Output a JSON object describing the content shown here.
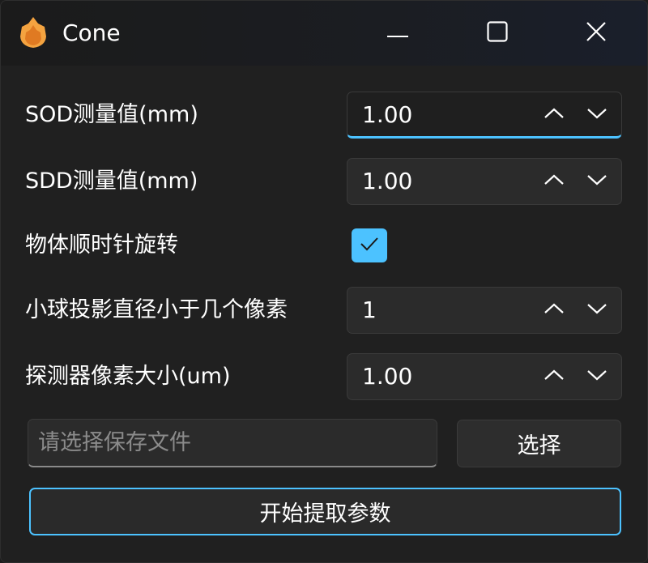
{
  "window": {
    "title": "Cone",
    "app_icon": "flame-icon",
    "controls": {
      "minimize": "minimize-icon",
      "maximize": "maximize-icon",
      "close": "close-icon"
    }
  },
  "form": {
    "sod": {
      "label": "SOD测量值(mm)",
      "value": "1.00"
    },
    "sdd": {
      "label": "SDD测量值(mm)",
      "value": "1.00"
    },
    "rotation": {
      "label": "物体顺时针旋转",
      "checked": true
    },
    "ball": {
      "label": "小球投影直径小于几个像素",
      "value": "1"
    },
    "pixel_size": {
      "label": "探测器像素大小(um)",
      "value": "1.00"
    },
    "save_file": {
      "placeholder": "请选择保存文件",
      "value": ""
    },
    "select_button": "选择",
    "start_button": "开始提取参数"
  },
  "colors": {
    "accent": "#4cc2ff",
    "background": "#202020",
    "control": "#2b2b2b",
    "icon": "#f4a340"
  }
}
